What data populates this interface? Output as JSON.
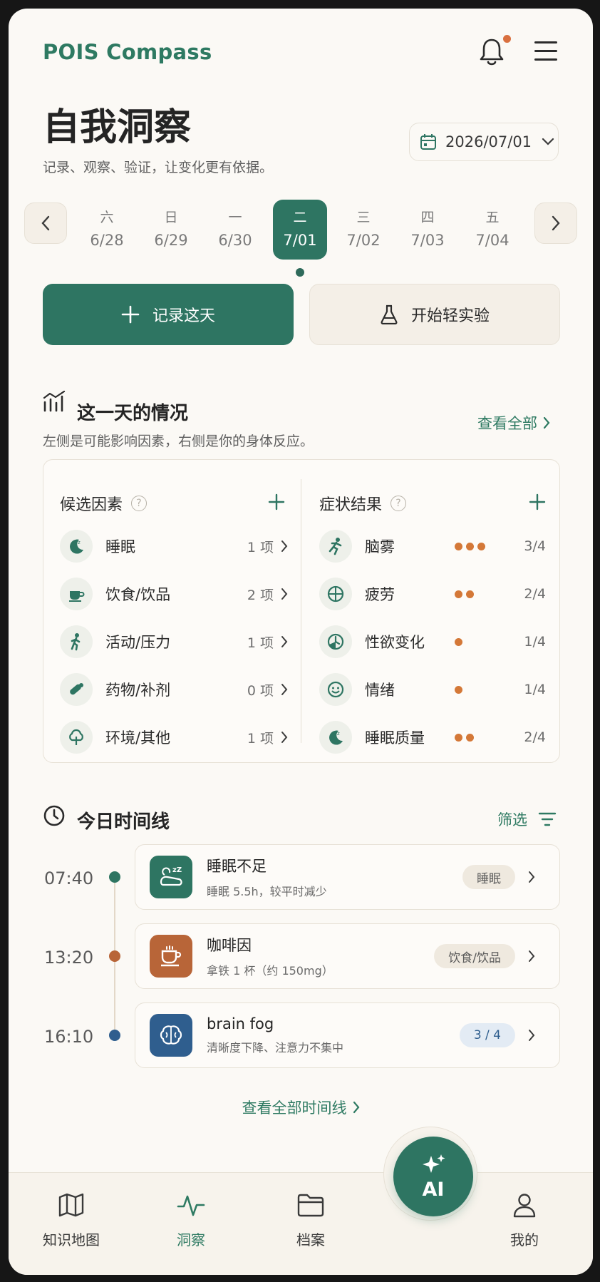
{
  "app": {
    "brand": "POIS Compass"
  },
  "header": {
    "title": "自我洞察",
    "subtitle": "记录、观察、验证，让变化更有依据。",
    "date": "2026/07/01"
  },
  "week": [
    {
      "weekday": "六",
      "date": "6/28",
      "active": false
    },
    {
      "weekday": "日",
      "date": "6/29",
      "active": false
    },
    {
      "weekday": "一",
      "date": "6/30",
      "active": false
    },
    {
      "weekday": "二",
      "date": "7/01",
      "active": true
    },
    {
      "weekday": "三",
      "date": "7/02",
      "active": false
    },
    {
      "weekday": "四",
      "date": "7/03",
      "active": false
    },
    {
      "weekday": "五",
      "date": "7/04",
      "active": false
    }
  ],
  "actions": {
    "record": "记录这天",
    "experiment": "开始轻实验"
  },
  "day_overview": {
    "title": "这一天的情况",
    "subtitle": "左侧是可能影响因素，右侧是你的身体反应。",
    "view_all": "查看全部",
    "factors": {
      "title": "候选因素",
      "items": [
        {
          "label": "睡眠",
          "count": "1 项",
          "icon": "moon-icon"
        },
        {
          "label": "饮食/饮品",
          "count": "2 项",
          "icon": "coffee-icon"
        },
        {
          "label": "活动/压力",
          "count": "1 项",
          "icon": "walk-icon"
        },
        {
          "label": "药物/补剂",
          "count": "0 项",
          "icon": "pill-icon"
        },
        {
          "label": "环境/其他",
          "count": "1 项",
          "icon": "tree-icon"
        }
      ]
    },
    "symptoms": {
      "title": "症状结果",
      "items": [
        {
          "label": "脑雾",
          "score": "3/4",
          "level": 3,
          "icon": "run-icon"
        },
        {
          "label": "疲劳",
          "score": "2/4",
          "level": 2,
          "icon": "circle-cross-icon"
        },
        {
          "label": "性欲变化",
          "score": "1/4",
          "level": 1,
          "icon": "clock-icon"
        },
        {
          "label": "情绪",
          "score": "1/4",
          "level": 1,
          "icon": "smile-icon"
        },
        {
          "label": "睡眠质量",
          "score": "2/4",
          "level": 2,
          "icon": "moon-icon"
        }
      ]
    }
  },
  "timeline": {
    "title": "今日时间线",
    "filter": "筛选",
    "entries": [
      {
        "time": "07:40",
        "title": "睡眠不足",
        "detail": "睡眠 5.5h，较平时减少",
        "tag": "睡眠",
        "color": "#2e7562",
        "tag_bg": "#efe9df",
        "tag_fg": "#5a5a5a",
        "icon": "sleep-icon"
      },
      {
        "time": "13:20",
        "title": "咖啡因",
        "detail": "拿铁 1 杯（约 150mg）",
        "tag": "饮食/饮品",
        "color": "#b86538",
        "tag_bg": "#efe9df",
        "tag_fg": "#5a5a5a",
        "icon": "coffee-icon"
      },
      {
        "time": "16:10",
        "title": "brain fog",
        "detail": "清晰度下降、注意力不集中",
        "tag": "3 / 4",
        "color": "#2f5e8e",
        "tag_bg": "#e3ebf4",
        "tag_fg": "#2f5e8e",
        "icon": "brain-icon"
      }
    ],
    "view_all": "查看全部时间线"
  },
  "nav": {
    "map": "知识地图",
    "insight": "洞察",
    "files": "档案",
    "ai": "AI",
    "me": "我的"
  },
  "colors": {
    "primary": "#2e7562",
    "accent_dot": "#d47838",
    "notify": "#d9703f"
  }
}
